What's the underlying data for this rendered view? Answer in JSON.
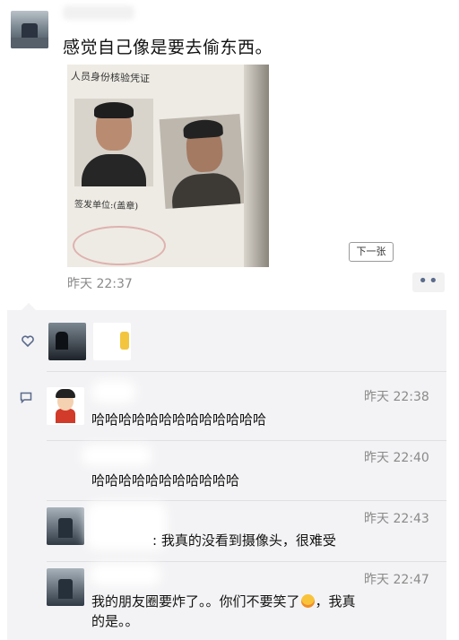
{
  "post": {
    "text": "感觉自己像是要去偷东西。",
    "photo_title": "人员身份核验凭证",
    "photo_caption": "签发单位:(盖章)",
    "next_label": "下一张",
    "time": "昨天 22:37",
    "more_label": "••"
  },
  "comments": [
    {
      "time": "昨天 22:38",
      "text": "哈哈哈哈哈哈哈哈哈哈哈哈哈"
    },
    {
      "time": "昨天 22:40",
      "text": "哈哈哈哈哈哈哈哈哈哈哈"
    },
    {
      "time": "昨天 22:43",
      "text": ": 我真的没看到摄像头，很难受"
    },
    {
      "time": "昨天 22:47",
      "text_line1_a": "我的朋友圈要炸了。。你们不要笑了",
      "text_line1_b": "，我真",
      "text_line2": "的是。。"
    }
  ],
  "icons": {
    "like": "heart-icon",
    "comment": "comment-icon",
    "emoji": "laughing-emoji-icon"
  },
  "colors": {
    "link_blue": "#5b6b8c",
    "panel_bg": "#f3f3f5",
    "time_grey": "#8a8a8a"
  }
}
